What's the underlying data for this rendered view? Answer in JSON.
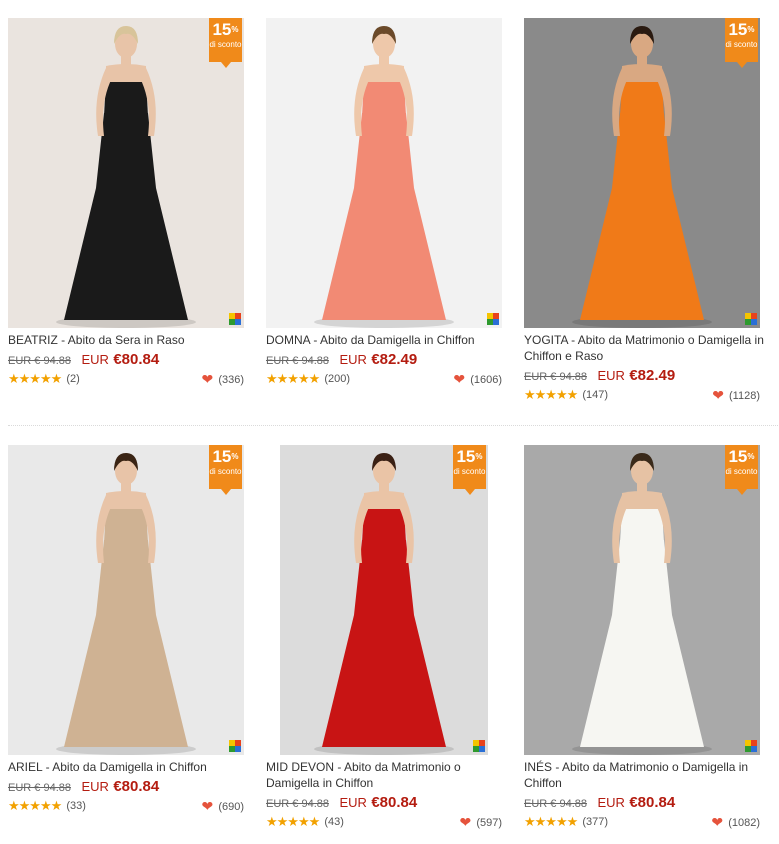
{
  "badge": {
    "percent": "15",
    "percent_sign": "%",
    "text": "di sconto"
  },
  "products": [
    {
      "title": "BEATRIZ - Abito da Sera in Raso",
      "old_price": "EUR € 94.88",
      "currency": "EUR",
      "price": "€80.84",
      "stars": "★★★★★",
      "reviews": "(2)",
      "favorites": "(336)",
      "discount": true,
      "colors": {
        "bg": "#eae4df",
        "dress": "#1a1a1a",
        "skin": "#e8c4a8",
        "hair": "#d8c49a"
      }
    },
    {
      "title": "DOMNA - Abito da Damigella in Chiffon",
      "old_price": "EUR € 94.88",
      "currency": "EUR",
      "price": "€82.49",
      "stars": "★★★★★",
      "reviews": "(200)",
      "favorites": "(1606)",
      "discount": false,
      "colors": {
        "bg": "#f2f2f2",
        "dress": "#f28a74",
        "skin": "#eec8aa",
        "hair": "#6b4a2a"
      }
    },
    {
      "title": "YOGITA - Abito da Matrimonio o Damigella in Chiffon e Raso",
      "old_price": "EUR € 94.88",
      "currency": "EUR",
      "price": "€82.49",
      "stars": "★★★★★",
      "reviews": "(147)",
      "favorites": "(1128)",
      "discount": true,
      "colors": {
        "bg": "#8a8a8a",
        "dress": "#f07a18",
        "skin": "#d9a882",
        "hair": "#2a1a10"
      }
    },
    {
      "title": "ARIEL - Abito da Damigella in Chiffon",
      "old_price": "EUR € 94.88",
      "currency": "EUR",
      "price": "€80.84",
      "stars": "★★★★★",
      "reviews": "(33)",
      "favorites": "(690)",
      "discount": true,
      "colors": {
        "bg": "#e9e9e9",
        "dress": "#cfb293",
        "skin": "#e8c4a8",
        "hair": "#3a2414"
      }
    },
    {
      "title": "MID DEVON - Abito da Matrimonio o Damigella in Chiffon",
      "old_price": "EUR € 94.88",
      "currency": "EUR",
      "price": "€80.84",
      "stars": "★★★★★",
      "reviews": "(43)",
      "favorites": "(597)",
      "discount": true,
      "colors": {
        "bg": "#dcdcdc",
        "dress": "#c81414",
        "skin": "#eac4a6",
        "hair": "#3a2014"
      }
    },
    {
      "title": "INÉS - Abito da Matrimonio o Damigella in Chiffon",
      "old_price": "EUR € 94.88",
      "currency": "EUR",
      "price": "€80.84",
      "stars": "★★★★★",
      "reviews": "(377)",
      "favorites": "(1082)",
      "discount": true,
      "colors": {
        "bg": "#a9a9a9",
        "dress": "#f6f6f2",
        "skin": "#e6c2a4",
        "hair": "#3a2a1a"
      }
    }
  ],
  "quad_colors": [
    "#f5c400",
    "#e8421c",
    "#2e9a2e",
    "#2a6fd6"
  ]
}
